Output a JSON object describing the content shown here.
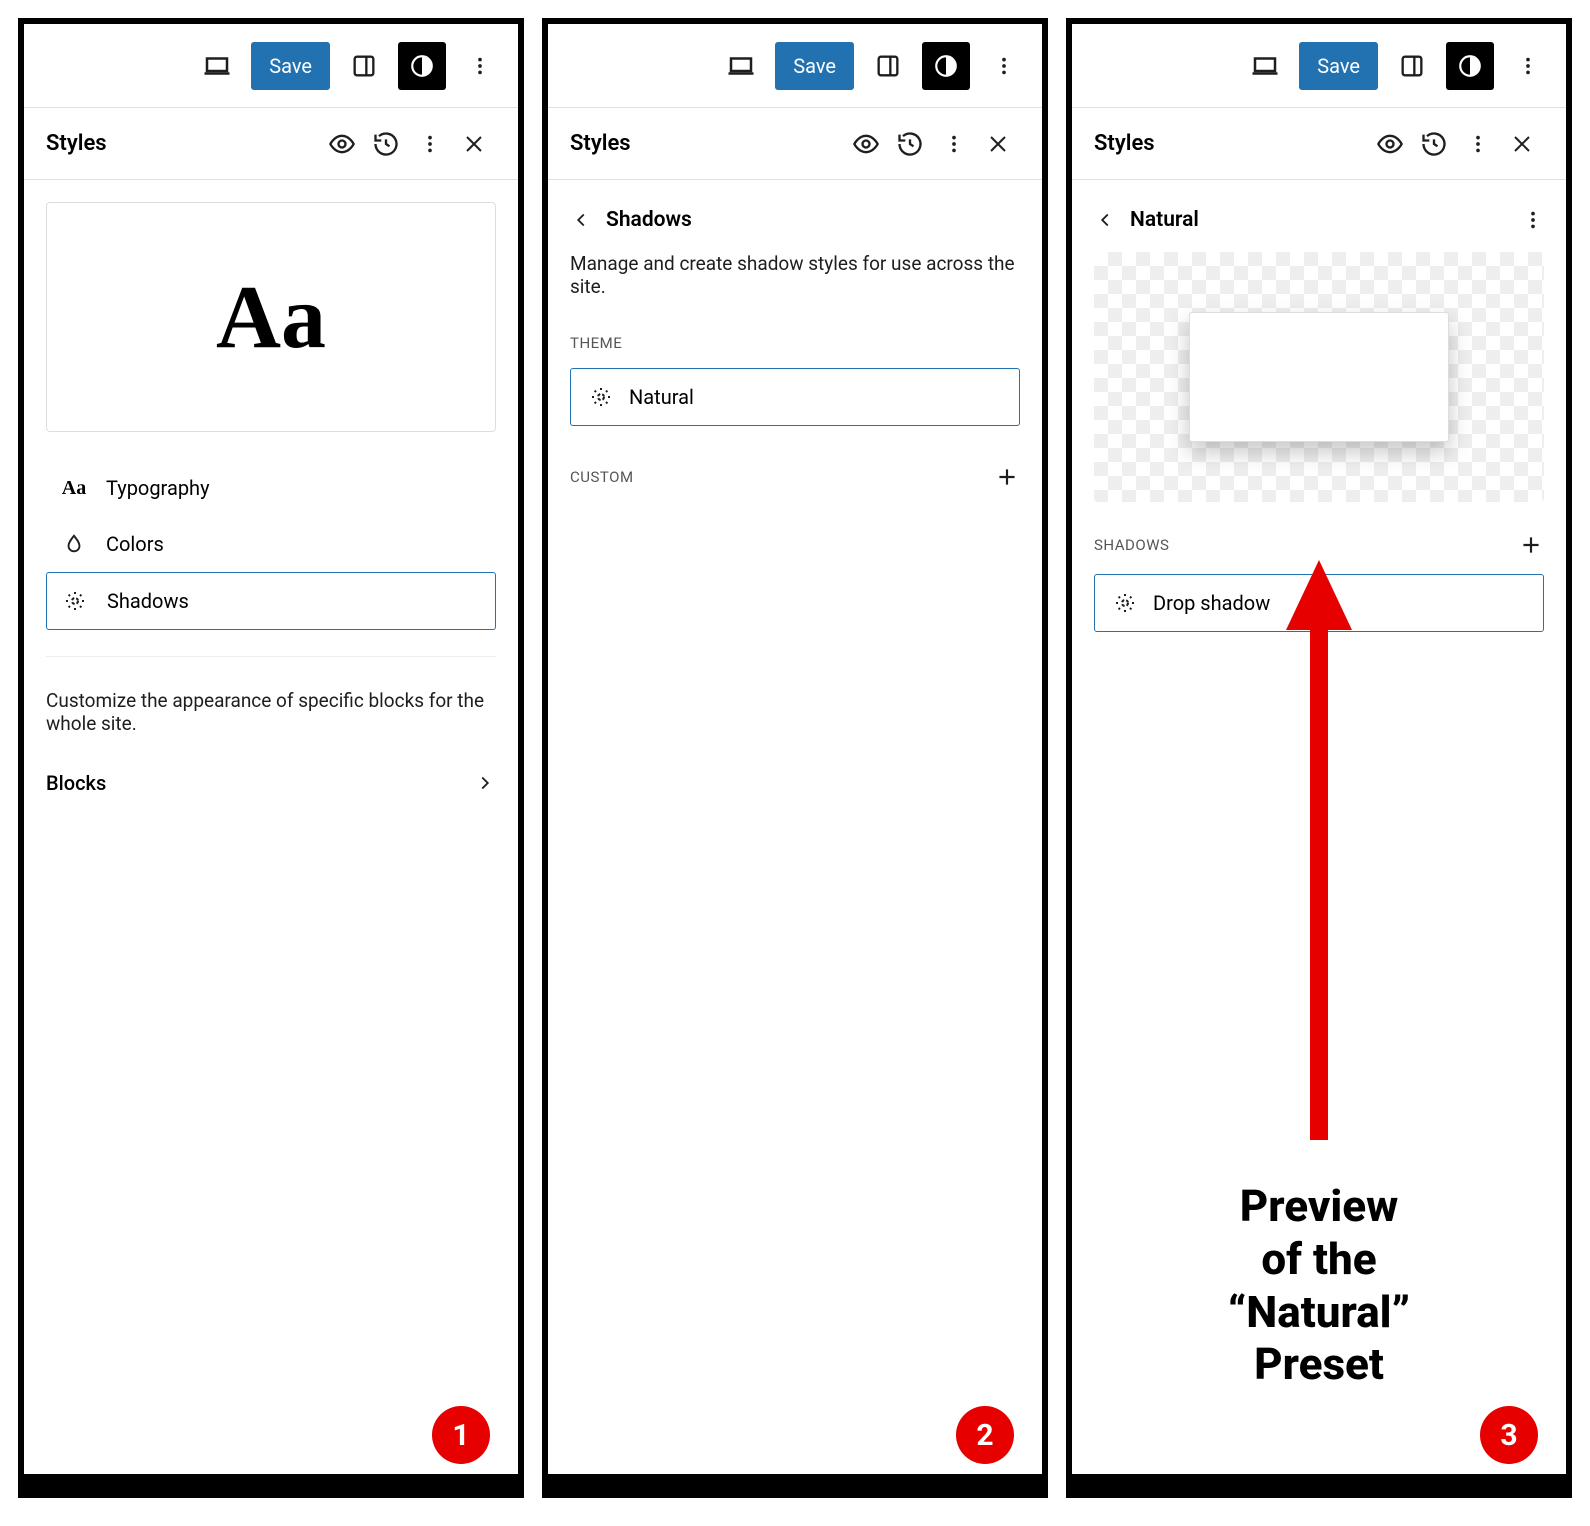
{
  "toolbar": {
    "save_label": "Save"
  },
  "styles_header": {
    "title": "Styles"
  },
  "panel1": {
    "preview_text": "Aa",
    "menu": {
      "typography": "Typography",
      "colors": "Colors",
      "shadows": "Shadows"
    },
    "blocks_description": "Customize the appearance of specific blocks for the whole site.",
    "blocks_link": "Blocks",
    "badge": "1"
  },
  "panel2": {
    "crumb_title": "Shadows",
    "description": "Manage and create shadow styles for use across the site.",
    "section_theme": "THEME",
    "theme_preset": "Natural",
    "section_custom": "CUSTOM",
    "badge": "2"
  },
  "panel3": {
    "crumb_title": "Natural",
    "section_shadows": "SHADOWS",
    "preset_row": "Drop shadow",
    "annotation": "Preview\nof the\n“Natural”\nPreset",
    "badge": "3"
  }
}
